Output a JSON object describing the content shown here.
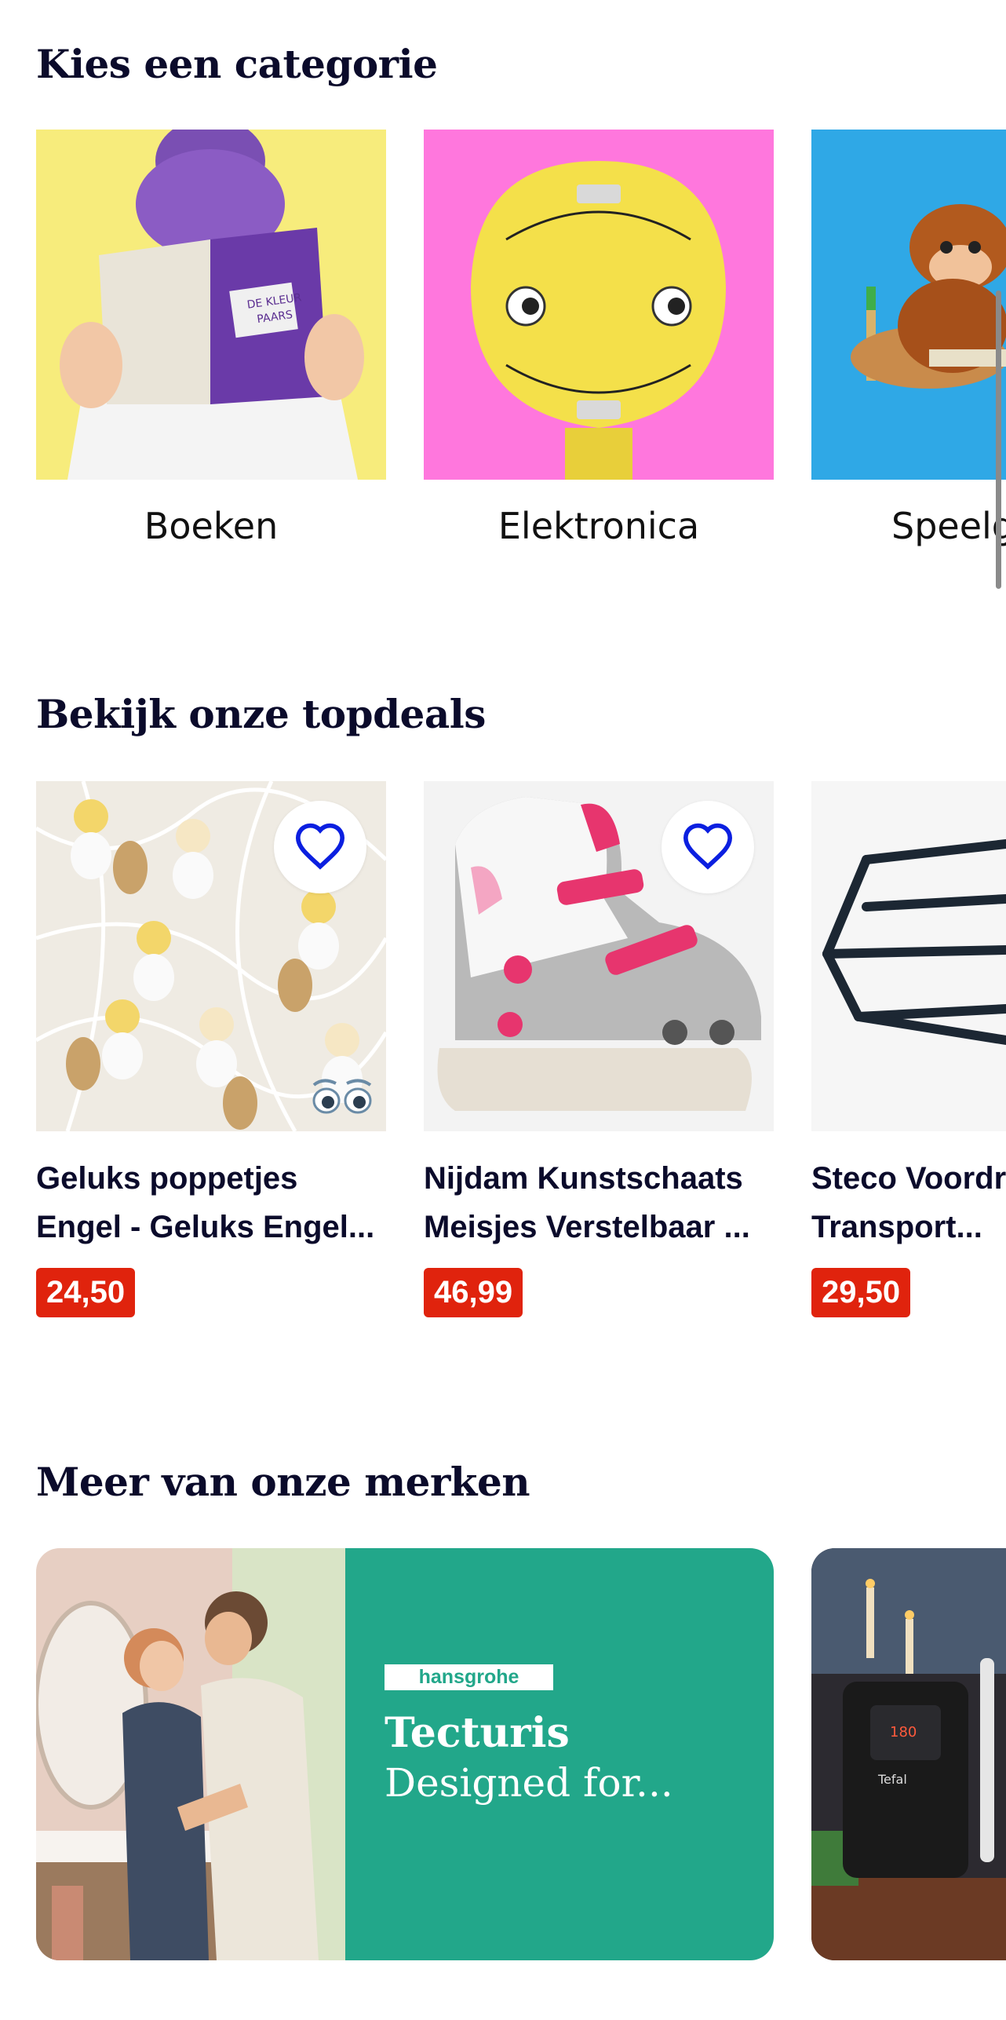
{
  "categories": {
    "title": "Kies een categorie",
    "items": [
      {
        "label": "Boeken",
        "bg": "#f7ec7c"
      },
      {
        "label": "Elektronica",
        "bg": "#ff77dd"
      },
      {
        "label": "Speelgoed",
        "bg": "#2fa8e6"
      }
    ]
  },
  "deals": {
    "title": "Bekijk onze topdeals",
    "items": [
      {
        "title_line1": "Geluks poppetjes",
        "title_line2": "Engel - Geluks Engel...",
        "price": "24,50"
      },
      {
        "title_line1": "Nijdam Kunstschaats",
        "title_line2": "Meisjes Verstelbaar ...",
        "price": "46,99"
      },
      {
        "title_line1": "Steco Voordrager",
        "title_line2": "Transport...",
        "price": "29,50"
      }
    ]
  },
  "brands": {
    "title": "Meer van onze merken",
    "items": [
      {
        "logo": "hansgrohe",
        "name": "Tecturis",
        "tagline": "Designed for...",
        "panel_color": "#22a78a"
      },
      {
        "logo": "Tefal"
      }
    ]
  },
  "icons": {
    "favorite": "heart-outline-icon",
    "more_photos": "eyes-icon"
  },
  "colors": {
    "price_badge": "#e0230d",
    "heart": "#0b1fe0",
    "text_dark": "#0b0b2b"
  }
}
